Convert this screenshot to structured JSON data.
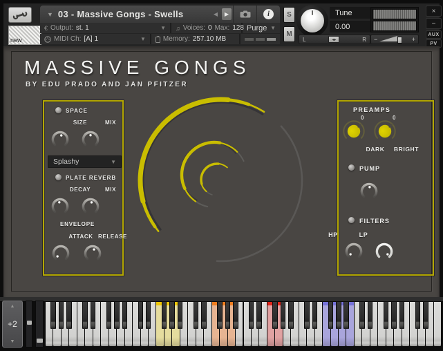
{
  "header": {
    "preset_title": "03 - Massive Gongs - Swells",
    "output_label": "Output:",
    "output_value": "st. 1",
    "voices_label": "Voices:",
    "voices_value": "0",
    "max_label": "Max:",
    "max_value": "128",
    "purge_label": "Purge",
    "midi_label": "MIDI Ch:",
    "midi_value": "[A] 1",
    "memory_label": "Memory:",
    "memory_value": "257.10 MB",
    "solo_label": "S",
    "mute_label": "M",
    "tune_label": "Tune",
    "tune_value": "0.00",
    "pan_left_label": "L",
    "pan_right_label": "R",
    "vol_minus_label": "−",
    "vol_plus_label": "+",
    "new_badge_label": "new",
    "close_label": "×",
    "minimize_label": "−",
    "aux_label": "aux",
    "pv_label": "pv"
  },
  "instrument": {
    "title": "MASSIVE GONGS",
    "subtitle": "BY EDU PRADO AND JAN PFITZER",
    "accent_color": "#c9bd00",
    "space_panel": {
      "space_label": "SPACE",
      "size_label": "SIZE",
      "size_value": 0.56,
      "mix_label": "MIX",
      "mix_value": 0.5,
      "reverb_type": "Splashy",
      "plate_label": "PLATE REVERB",
      "decay_label": "DECAY",
      "decay_value": 0.46,
      "mix2_label": "MIX",
      "mix2_value": 0.55,
      "envelope_label": "ENVELOPE",
      "attack_label": "ATTACK",
      "attack_value": 0.02,
      "release_label": "RELEASE",
      "release_value": 0.57
    },
    "fx_panel": {
      "preamps_label": "PREAMPS",
      "dark_label": "DARK",
      "dark_value": "0",
      "bright_label": "BRIGHT",
      "bright_value": "0",
      "pump_label": "PUMP",
      "pump_value": 0.53,
      "filters_label": "FILTERS",
      "hp_label": "HP",
      "hp_value": 0.02,
      "lp_label": "LP",
      "lp_value": 0.98
    }
  },
  "keyboard": {
    "transpose_value": "+2",
    "white_key_count": 50,
    "black_after_pattern": [
      0,
      1,
      2,
      4,
      5
    ],
    "colored_groups": [
      {
        "keys": [
          14,
          15,
          16
        ],
        "stripe": "#edc607",
        "body": "#e5dc9e"
      },
      {
        "keys": [
          21,
          22,
          23
        ],
        "stripe": "#f07d1e",
        "body": "#e6b492"
      },
      {
        "keys": [
          28,
          29
        ],
        "stripe": "#e2271c",
        "body": "#e1a2a2"
      },
      {
        "keys": [
          35,
          36,
          37,
          38
        ],
        "stripe": "#7672d8",
        "body": "#a9a5dc"
      }
    ]
  }
}
